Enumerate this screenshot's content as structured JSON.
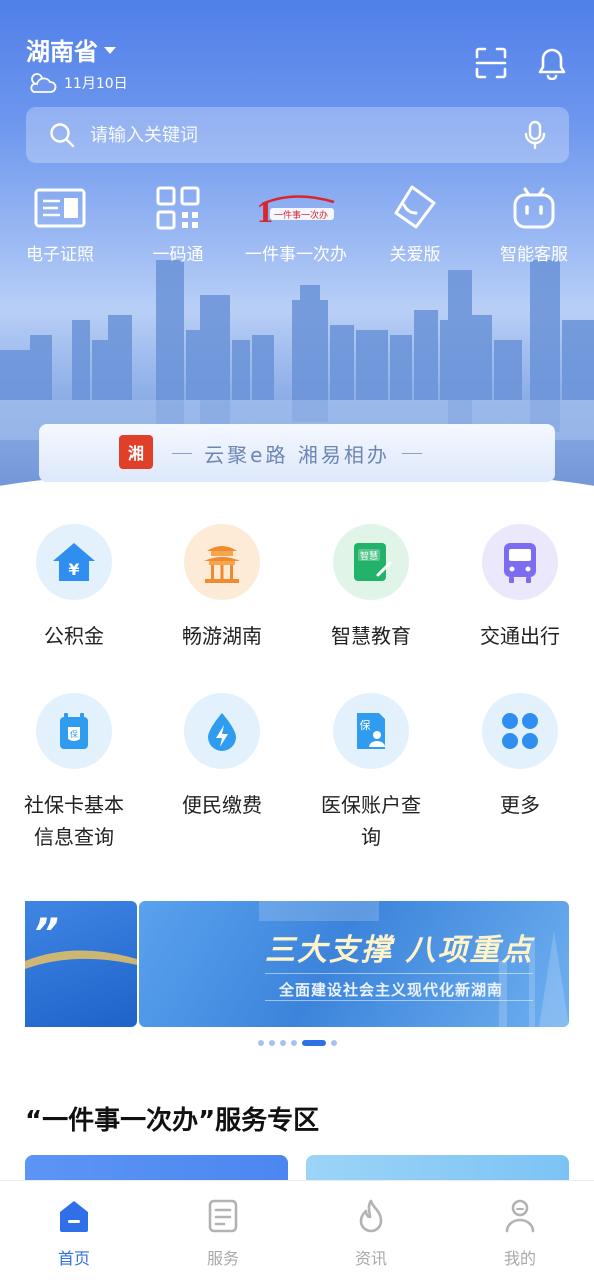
{
  "header": {
    "region": "湖南省",
    "weather_date": "11月10日",
    "search_placeholder": "请输入关键词"
  },
  "quick_actions": [
    {
      "label": "电子证照",
      "icon": "id-card-icon"
    },
    {
      "label": "一码通",
      "icon": "qr-code-icon"
    },
    {
      "label": "一件事一次办",
      "icon": "one-thing-logo"
    },
    {
      "label": "关爱版",
      "icon": "care-tag-icon"
    },
    {
      "label": "智能客服",
      "icon": "robot-icon"
    }
  ],
  "slogan": {
    "logo_text": "湘",
    "text": "云聚e路  湘易相办"
  },
  "services": [
    {
      "label": "公积金",
      "icon": "house-yuan-icon"
    },
    {
      "label": "畅游湖南",
      "icon": "pavilion-icon"
    },
    {
      "label": "智慧教育",
      "icon": "smart-book-icon",
      "icon_text": "智慧"
    },
    {
      "label": "交通出行",
      "icon": "bus-icon"
    },
    {
      "label": "社保卡基本信息查询",
      "icon": "social-card-icon",
      "icon_text": "保"
    },
    {
      "label": "便民缴费",
      "icon": "water-bolt-icon"
    },
    {
      "label": "医保账户查询",
      "icon": "medical-insurance-icon",
      "icon_text": "保"
    },
    {
      "label": "更多",
      "icon": "four-petal-icon"
    }
  ],
  "banner": {
    "title": "三大支撑 八项重点",
    "subtitle": "全面建设社会主义现代化新湖南",
    "quote_mark": "”",
    "dot_count": 6,
    "active_dot": 4
  },
  "section": {
    "title": "“一件事一次办”服务专区"
  },
  "tabbar": [
    {
      "label": "首页",
      "icon": "home-icon",
      "active": true
    },
    {
      "label": "服务",
      "icon": "service-doc-icon",
      "active": false
    },
    {
      "label": "资讯",
      "icon": "flame-icon",
      "active": false
    },
    {
      "label": "我的",
      "icon": "profile-icon",
      "active": false
    }
  ],
  "colors": {
    "primary": "#2f6fe8",
    "hero_top": "#4f7fe8",
    "inactive_tab": "#a9a9a9"
  }
}
